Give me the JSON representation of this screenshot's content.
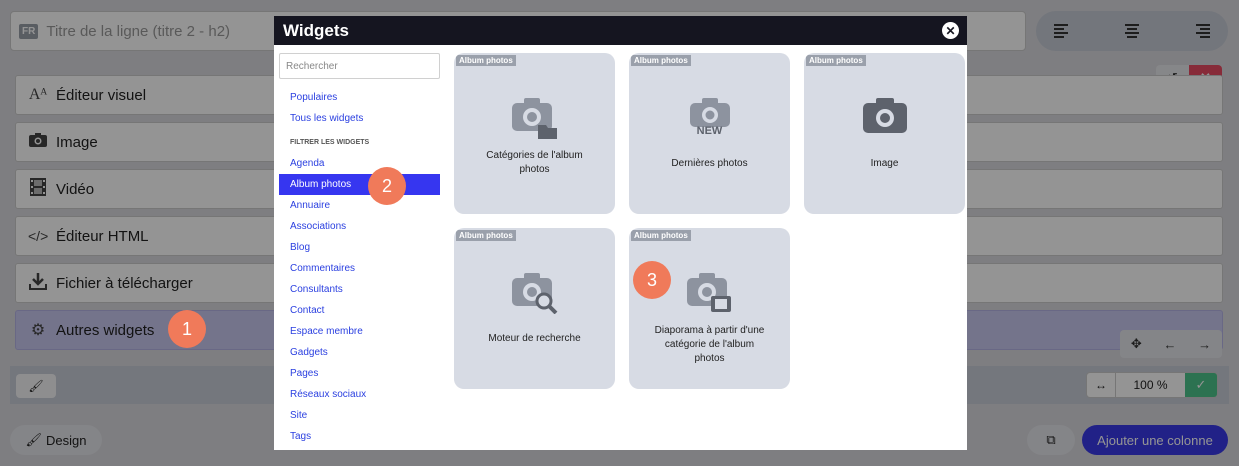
{
  "editor": {
    "flag": "FR",
    "title_placeholder": "Titre de la ligne (titre 2 - h2)",
    "rows": [
      {
        "label": "Éditeur visuel",
        "icon": "text-icon"
      },
      {
        "label": "Image",
        "icon": "camera-icon"
      },
      {
        "label": "Vidéo",
        "icon": "film-icon"
      },
      {
        "label": "Éditeur HTML",
        "icon": "code-icon"
      },
      {
        "label": "Fichier à télécharger",
        "icon": "download-icon"
      },
      {
        "label": "Autres widgets",
        "icon": "gears-icon"
      }
    ],
    "zoom_value": "100 %",
    "design_label": "Design",
    "add_column_label": "Ajouter une colonne"
  },
  "modal": {
    "title": "Widgets",
    "search_placeholder": "Rechercher",
    "top_links": [
      "Populaires",
      "Tous les widgets"
    ],
    "filter_heading": "FILTRER LES WIDGETS",
    "filters": [
      "Agenda",
      "Album photos",
      "Annuaire",
      "Associations",
      "Blog",
      "Commentaires",
      "Consultants",
      "Contact",
      "Espace membre",
      "Gadgets",
      "Pages",
      "Réseaux sociaux",
      "Site",
      "Tags"
    ],
    "active_filter": "Album photos",
    "tiles": [
      {
        "badge": "Album photos",
        "label": "Catégories de l'album photos",
        "icon": "camera-folder-icon"
      },
      {
        "badge": "Album photos",
        "label": "Dernières photos",
        "icon": "camera-new-icon",
        "icon_text": "NEW"
      },
      {
        "badge": "Album photos",
        "label": "Image",
        "icon": "camera-icon"
      },
      {
        "badge": "Album photos",
        "label": "Moteur de recherche",
        "icon": "camera-search-icon"
      },
      {
        "badge": "Album photos",
        "label": "Diaporama à partir d'une catégorie de l'album photos",
        "icon": "camera-slideshow-icon"
      }
    ]
  },
  "markers": [
    "1",
    "2",
    "3"
  ],
  "colors": {
    "accent": "#3636f0",
    "marker": "#f07a5a",
    "active_row": "#c9c8f0",
    "danger": "#e94a62",
    "success": "#4cc48c"
  }
}
